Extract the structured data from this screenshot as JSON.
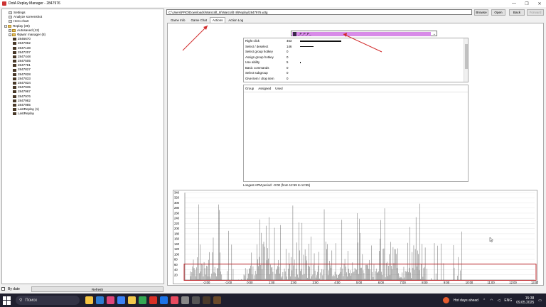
{
  "window": {
    "title": "DotA Replay Manager - 2847976"
  },
  "tree": [
    {
      "label": "Settings",
      "indent": 1,
      "icon": "doc"
    },
    {
      "label": "Analyze screenshot",
      "indent": 1,
      "icon": "doc"
    },
    {
      "label": "Hero chart",
      "indent": 1,
      "icon": "doc"
    },
    {
      "label": "Replay (39)",
      "indent": 0,
      "icon": "folder",
      "exp": "-"
    },
    {
      "label": "Autosaved (12)",
      "indent": 1,
      "icon": "folder",
      "exp": "+"
    },
    {
      "label": "Фрмат manager (8)",
      "indent": 1,
      "icon": "folder",
      "exp": "+"
    },
    {
      "label": "2846670",
      "indent": 2,
      "icon": "replay"
    },
    {
      "label": "2847062",
      "indent": 2,
      "icon": "replay"
    },
    {
      "label": "2847138",
      "indent": 2,
      "icon": "replay"
    },
    {
      "label": "2847207",
      "indent": 2,
      "icon": "replay"
    },
    {
      "label": "2847448",
      "indent": 2,
      "icon": "replay"
    },
    {
      "label": "2847505",
      "indent": 2,
      "icon": "replay"
    },
    {
      "label": "2847781",
      "indent": 2,
      "icon": "replay"
    },
    {
      "label": "2847827",
      "indent": 2,
      "icon": "replay"
    },
    {
      "label": "2847828",
      "indent": 2,
      "icon": "replay"
    },
    {
      "label": "2847833",
      "indent": 2,
      "icon": "replay"
    },
    {
      "label": "2847834",
      "indent": 2,
      "icon": "replay"
    },
    {
      "label": "2847935",
      "indent": 2,
      "icon": "replay"
    },
    {
      "label": "2847967",
      "indent": 2,
      "icon": "replay"
    },
    {
      "label": "2847976",
      "indent": 2,
      "icon": "replay"
    },
    {
      "label": "2847982",
      "indent": 2,
      "icon": "replay"
    },
    {
      "label": "2847985",
      "indent": 2,
      "icon": "replay"
    },
    {
      "label": "LastReplay (1)",
      "indent": 2,
      "icon": "replay"
    },
    {
      "label": "LastReplay",
      "indent": 2,
      "icon": "replay"
    }
  ],
  "bottom": {
    "by_date": "By date",
    "refresh": "Refresh"
  },
  "path": "C:\\Users\\PRO\\Downloads\\Warcraft_III\\Warcraft III\\Replay\\2847976.w3g",
  "buttons": {
    "browse": "Browse",
    "open": "Open",
    "back": "Back",
    "forward": "Forward"
  },
  "tabs": [
    "Game Info",
    "Game Chat",
    "Actions",
    "Action Log"
  ],
  "player": {
    "name": "_P_P_P_"
  },
  "actions": [
    {
      "label": "Right click",
      "value": "463",
      "frac": 1.0
    },
    {
      "label": "Select / deselect",
      "value": "146",
      "frac": 0.32
    },
    {
      "label": "Select group hotkey",
      "value": "0",
      "frac": 0
    },
    {
      "label": "Assign group hotkey",
      "value": "0",
      "frac": 0
    },
    {
      "label": "Use ability",
      "value": "5",
      "frac": 0.01
    },
    {
      "label": "Basic commands",
      "value": "0",
      "frac": 0
    },
    {
      "label": "Select subgroup",
      "value": "0",
      "frac": 0
    },
    {
      "label": "Give item / drop item",
      "value": "0",
      "frac": 0
    }
  ],
  "group_table": {
    "headers": [
      "Group",
      "Assigned",
      "Used"
    ]
  },
  "apm_text": "Longest APM period: -0:00 (from 12:59 to 12:55)",
  "chart_data": {
    "type": "bar",
    "ylim": [
      0,
      340
    ],
    "yticks": [
      "340",
      "320",
      "300",
      "280",
      "260",
      "240",
      "220",
      "200",
      "180",
      "160",
      "140",
      "120",
      "100",
      "80",
      "60",
      "40",
      "20"
    ],
    "xticks": [
      "-2:00",
      "-1:00",
      "0:00",
      "1:00",
      "2:00",
      "3:00",
      "4:00",
      "5:00",
      "6:00",
      "7:00",
      "8:00",
      "9:00",
      "10:00",
      "11:00",
      "12:00",
      "13:00"
    ],
    "xlim_min": [
      -3.0,
      13.0
    ],
    "highlight_color": "#c0282d"
  },
  "taskbar": {
    "search_placeholder": "Поиск",
    "weather": "Hot days ahead",
    "lang": "ENG",
    "time": "15:38",
    "date": "09.05.2025"
  }
}
